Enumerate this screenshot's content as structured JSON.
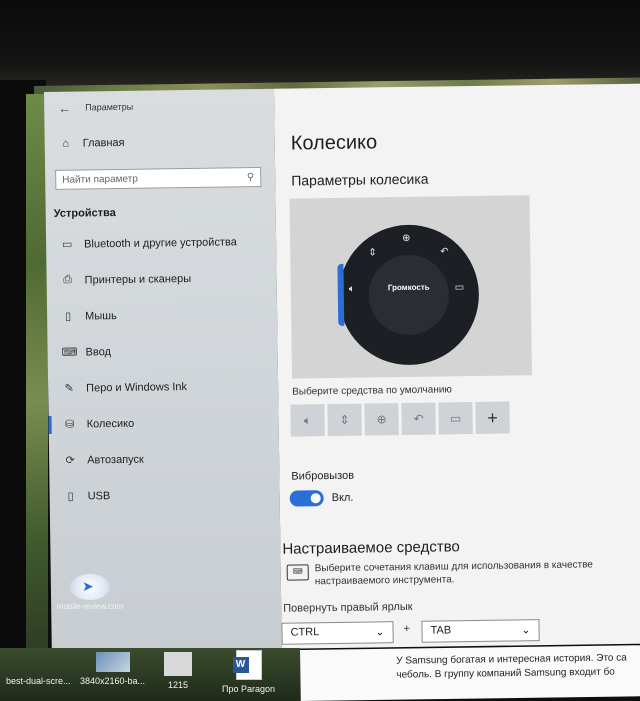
{
  "window": {
    "title": "Параметры"
  },
  "sidebar": {
    "home_label": "Главная",
    "search_placeholder": "Найти параметр",
    "section": "Устройства",
    "items": [
      {
        "label": "Bluetooth и другие устройства",
        "icon": "bluetooth-icon"
      },
      {
        "label": "Принтеры и сканеры",
        "icon": "printer-icon"
      },
      {
        "label": "Мышь",
        "icon": "mouse-icon"
      },
      {
        "label": "Ввод",
        "icon": "keyboard-icon"
      },
      {
        "label": "Перо и Windows Ink",
        "icon": "pen-icon"
      },
      {
        "label": "Колесико",
        "icon": "wheel-icon",
        "active": true
      },
      {
        "label": "Автозапуск",
        "icon": "autoplay-icon"
      },
      {
        "label": "USB",
        "icon": "usb-icon"
      }
    ]
  },
  "content": {
    "page_title": "Колесико",
    "wheel_settings_heading": "Параметры колесика",
    "dial_center_label": "Громкость",
    "default_tools_caption": "Выберите средства по умолчанию",
    "tools": [
      "volume-icon",
      "scroll-icon",
      "zoom-icon",
      "undo-icon",
      "brightness-icon",
      "add-icon"
    ],
    "vibration_label": "Вибровызов",
    "vibration_state": "Вкл.",
    "custom_tool_heading": "Настраиваемое средство",
    "custom_tool_description": "Выберите сочетания клавиш для использования в качестве настраиваемого инструмента.",
    "rotate_right_label": "Повернуть правый ярлык",
    "key1": "CTRL",
    "plus": "+",
    "key2": "TAB"
  },
  "taskbar": {
    "items": [
      "best-dual-scre...",
      "3840x2160-ba...",
      "1215",
      "Про Paragon"
    ]
  },
  "document": {
    "line1": "У Samsung богатая и интересная история. Это са",
    "line2": "чеболь. В группу компаний Samsung входит бо"
  },
  "watermark": {
    "text": "mobile-review.com"
  },
  "colors": {
    "accent": "#2b6fd6",
    "dial": "#1c1f24"
  }
}
